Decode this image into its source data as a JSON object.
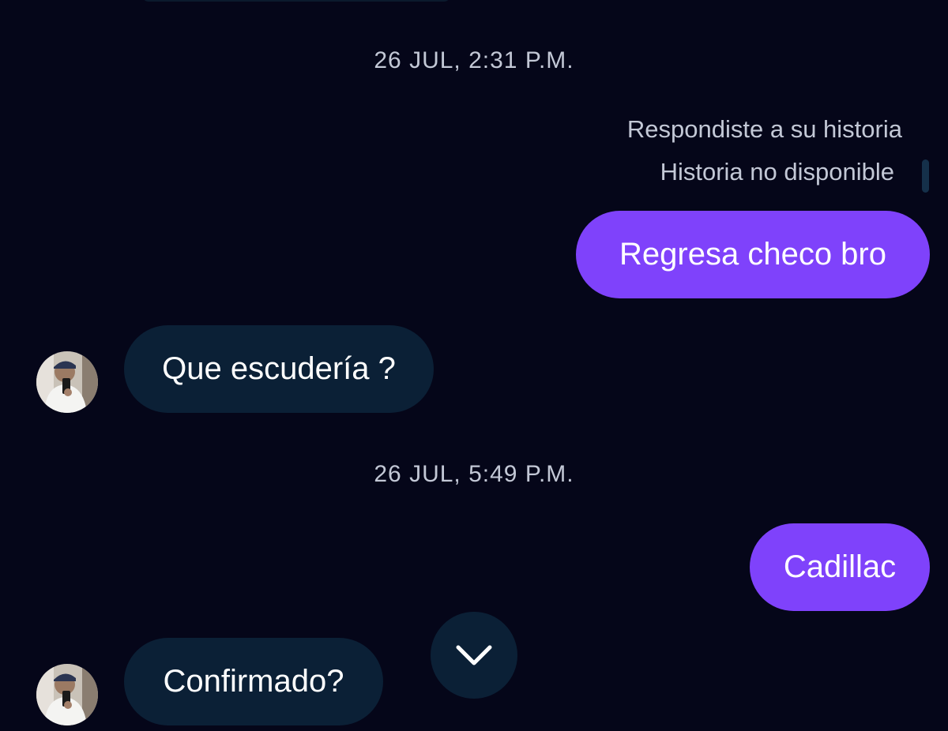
{
  "conversation": {
    "timestamp_1": "26 JUL, 2:31 P.M.",
    "reply_label": "Respondiste a su historia",
    "story_unavailable": "Historia no disponible",
    "msg_out_1": "Regresa checo bro",
    "msg_in_1": "Que escudería ?",
    "timestamp_2": "26 JUL, 5:49 P.M.",
    "msg_out_2": "Cadillac",
    "msg_in_2": "Confirmado?"
  },
  "colors": {
    "background": "#050619",
    "outgoing_bubble": "#7f42fb",
    "incoming_bubble": "#0b2036",
    "meta_text": "#c3c8d6"
  },
  "icons": {
    "scroll_down": "chevron-down-icon",
    "contact_avatar": "avatar"
  }
}
